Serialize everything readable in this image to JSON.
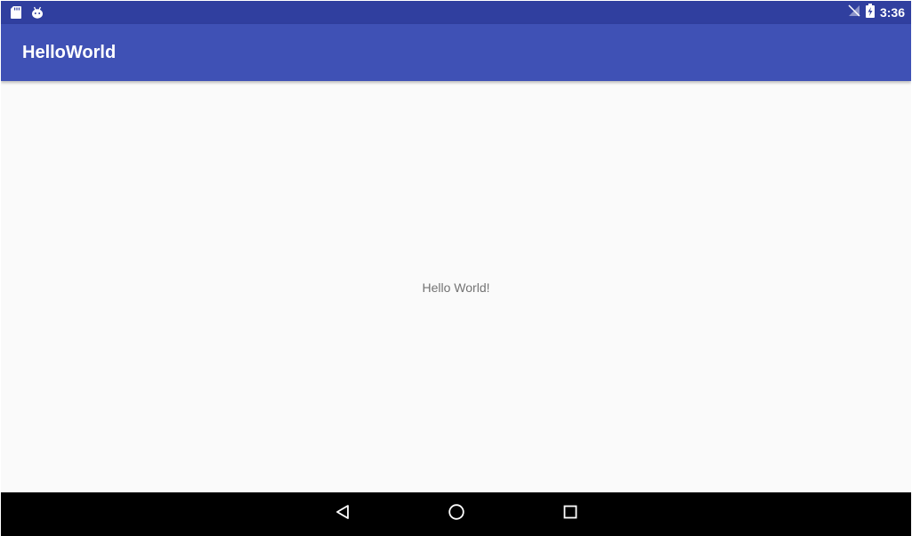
{
  "status_bar": {
    "icons_left": [
      "sd-card-icon",
      "android-debug-icon"
    ],
    "icons_right": [
      "no-signal-icon",
      "battery-charging-icon"
    ],
    "time": "3:36",
    "background": "#303f9f"
  },
  "app_bar": {
    "title": "HelloWorld",
    "background": "#3f51b5"
  },
  "content": {
    "text": "Hello World!",
    "background": "#fafafa"
  },
  "nav_bar": {
    "buttons": [
      "back-icon",
      "home-icon",
      "recents-icon"
    ],
    "background": "#000000"
  }
}
